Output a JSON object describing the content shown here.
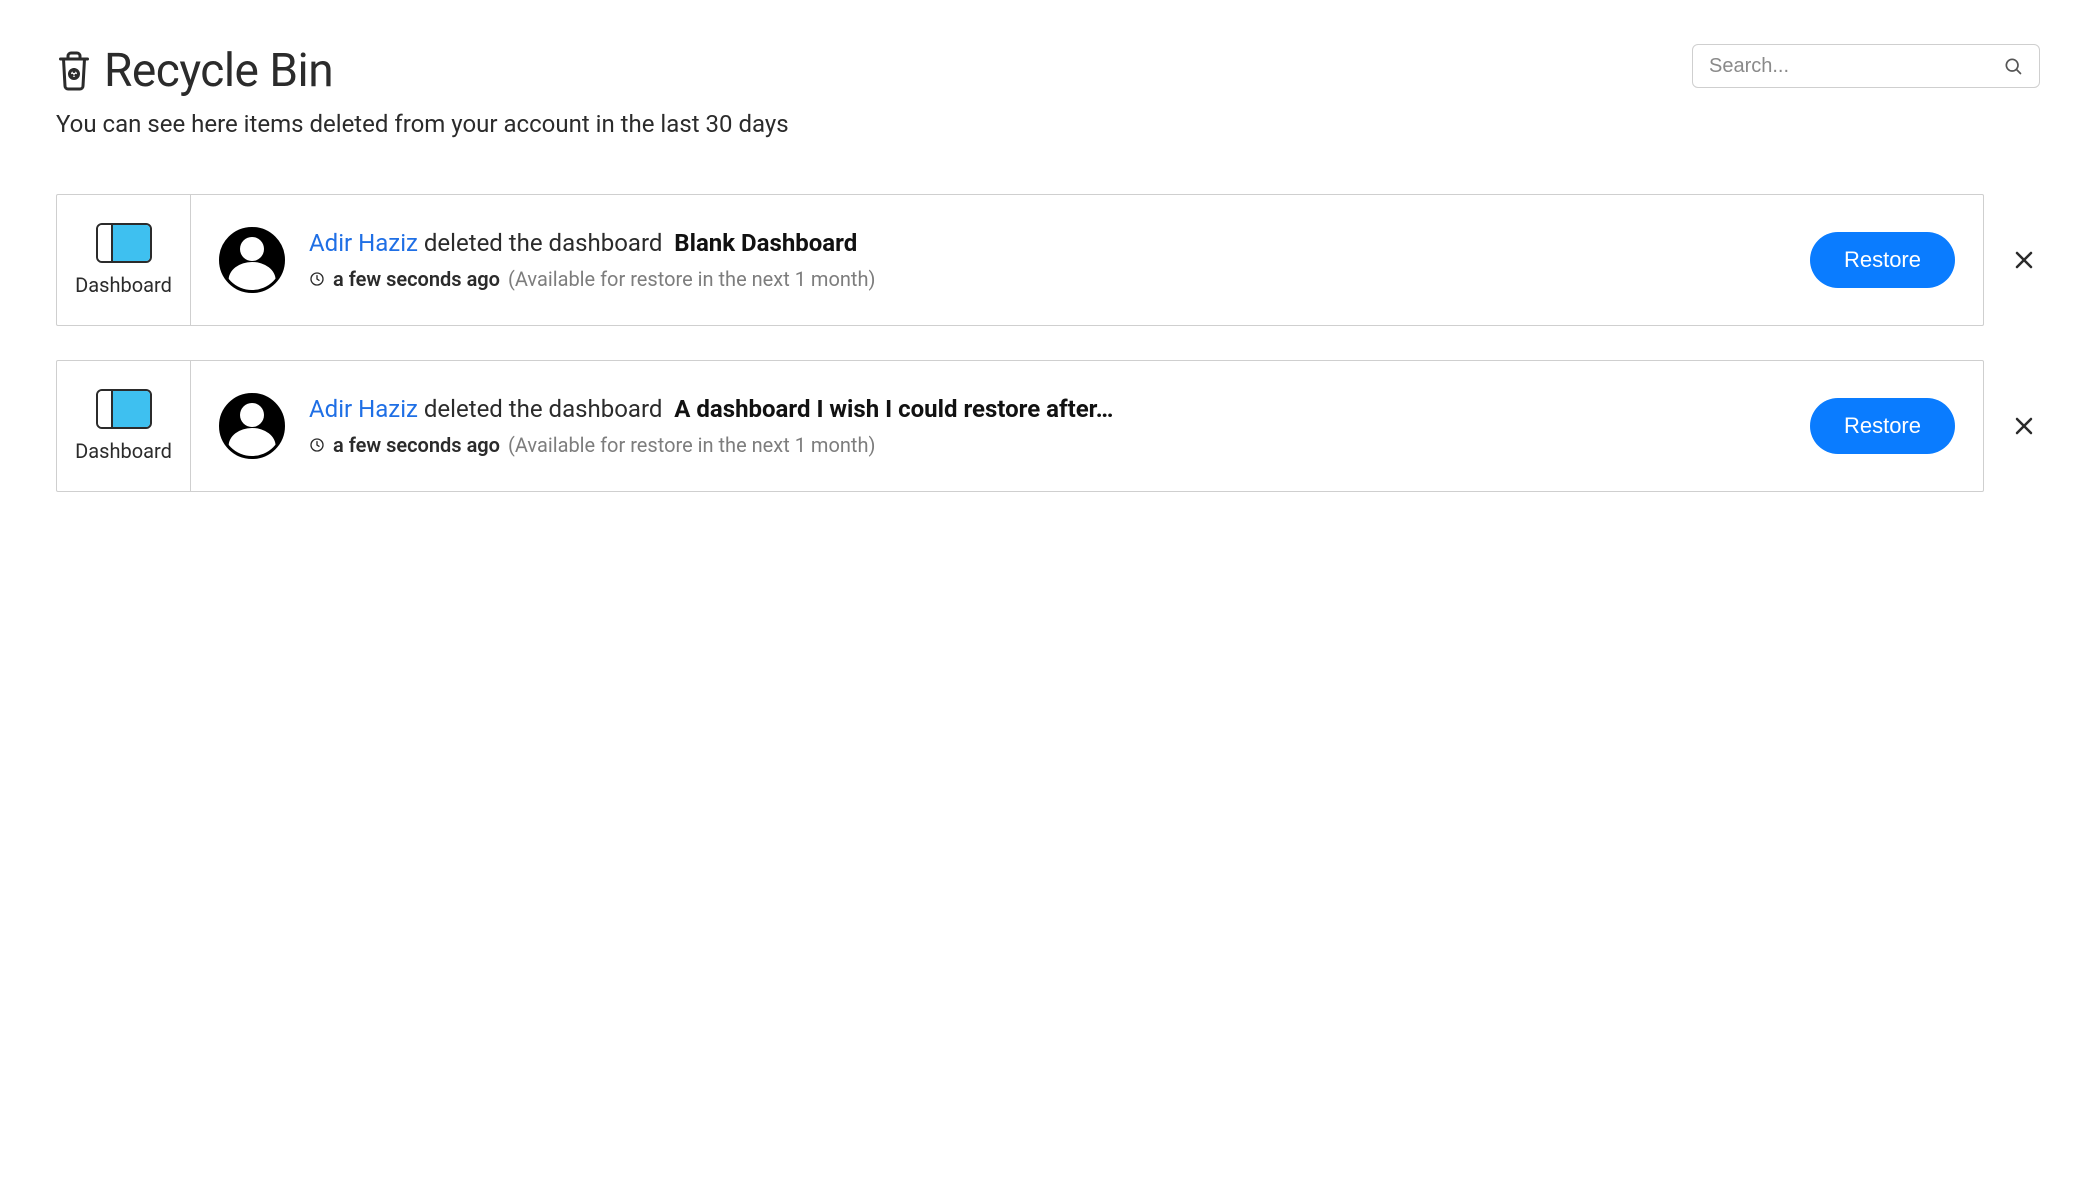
{
  "header": {
    "title": "Recycle Bin",
    "subtitle": "You can see here items deleted from your account in the last 30 days"
  },
  "search": {
    "placeholder": "Search..."
  },
  "actions": {
    "restore_label": "Restore"
  },
  "items": [
    {
      "type_label": "Dashboard",
      "user": "Adir Haziz",
      "action_text": "deleted the dashboard",
      "item_name": "Blank Dashboard",
      "time_ago": "a few seconds ago",
      "availability": "(Available for restore in the next 1 month)"
    },
    {
      "type_label": "Dashboard",
      "user": "Adir Haziz",
      "action_text": "deleted the dashboard",
      "item_name": "A dashboard I wish I could restore after…",
      "time_ago": "a few seconds ago",
      "availability": "(Available for restore in the next 1 month)"
    }
  ]
}
